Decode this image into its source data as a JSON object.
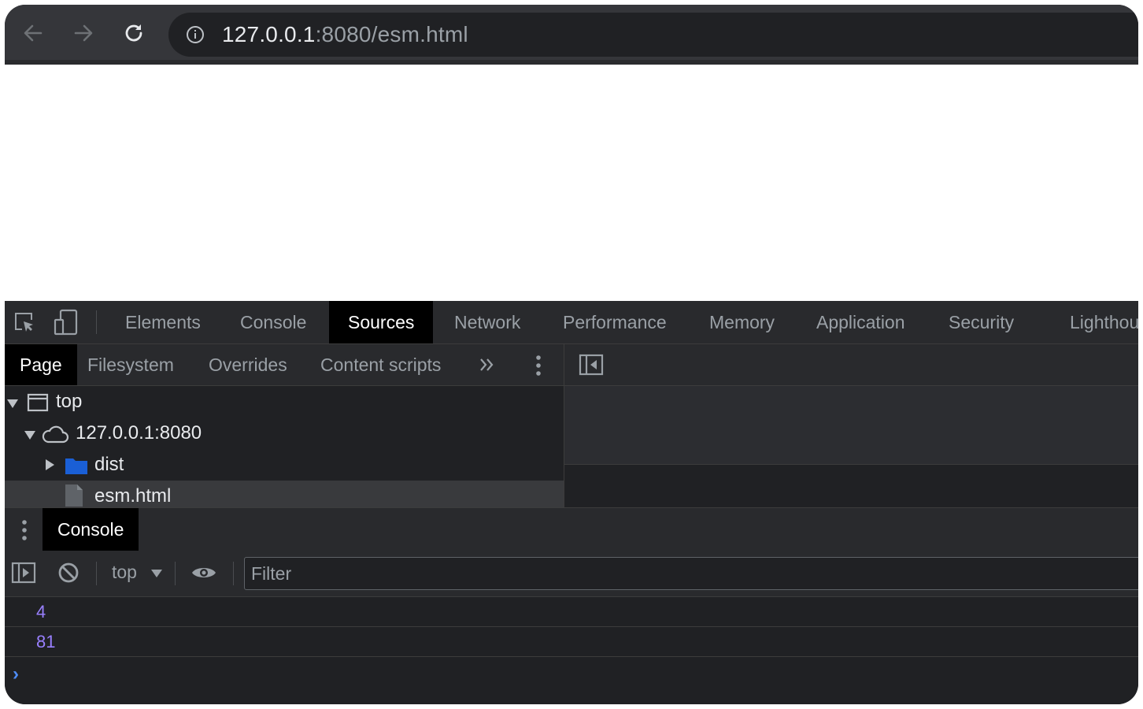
{
  "browser": {
    "url_host": "127.0.0.1",
    "url_rest": ":8080/esm.html"
  },
  "devtools": {
    "tabs": [
      "Elements",
      "Console",
      "Sources",
      "Network",
      "Performance",
      "Memory",
      "Application",
      "Security",
      "Lighthouse"
    ],
    "active_tab": "Sources",
    "sources": {
      "sub_tabs": [
        "Page",
        "Filesystem",
        "Overrides",
        "Content scripts"
      ],
      "active_sub_tab": "Page",
      "tree": {
        "top": "top",
        "host": "127.0.0.1:8080",
        "folder": "dist",
        "file": "esm.html"
      }
    },
    "drawer": {
      "tab": "Console",
      "context": "top",
      "filter_placeholder": "Filter",
      "logs": [
        "4",
        "81"
      ],
      "prompt": "›"
    }
  },
  "colors": {
    "number_log": "#9980ff",
    "prompt": "#4e8cf6"
  }
}
